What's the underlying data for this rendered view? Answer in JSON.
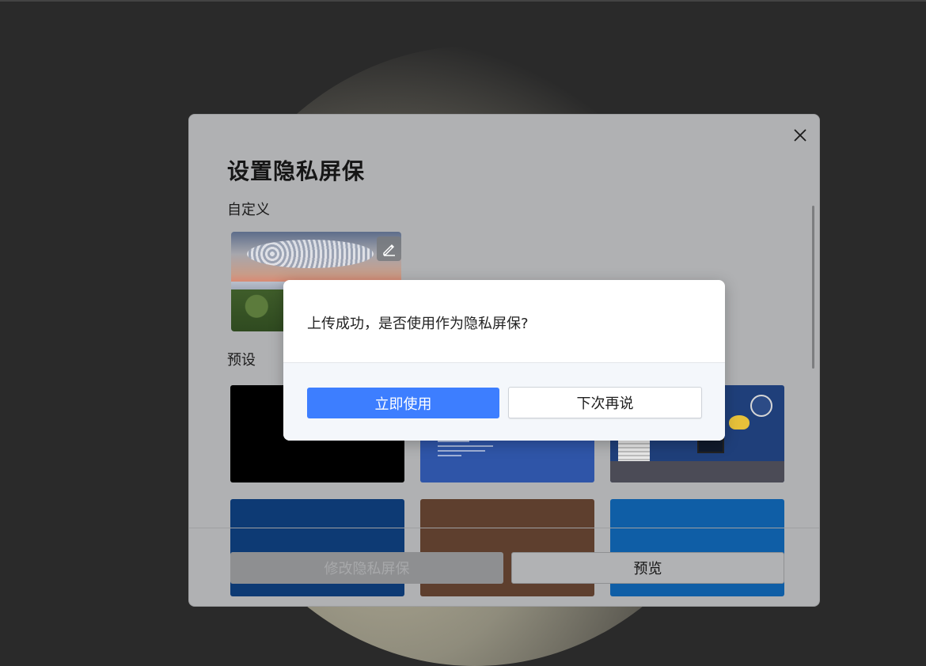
{
  "main_dialog": {
    "title": "设置隐私屏保",
    "custom_label": "自定义",
    "preset_label": "预设",
    "buttons": {
      "modify": "修改隐私屏保",
      "preview": "预览"
    },
    "icons": {
      "close": "close-icon",
      "edit": "edit-pencil-icon"
    }
  },
  "confirm_dialog": {
    "message": "上传成功，是否使用作为隐私屏保?",
    "use_now": "立即使用",
    "later": "下次再说"
  },
  "colors": {
    "primary": "#3d7eff",
    "overlay_dialog": "#b0b1b3"
  }
}
